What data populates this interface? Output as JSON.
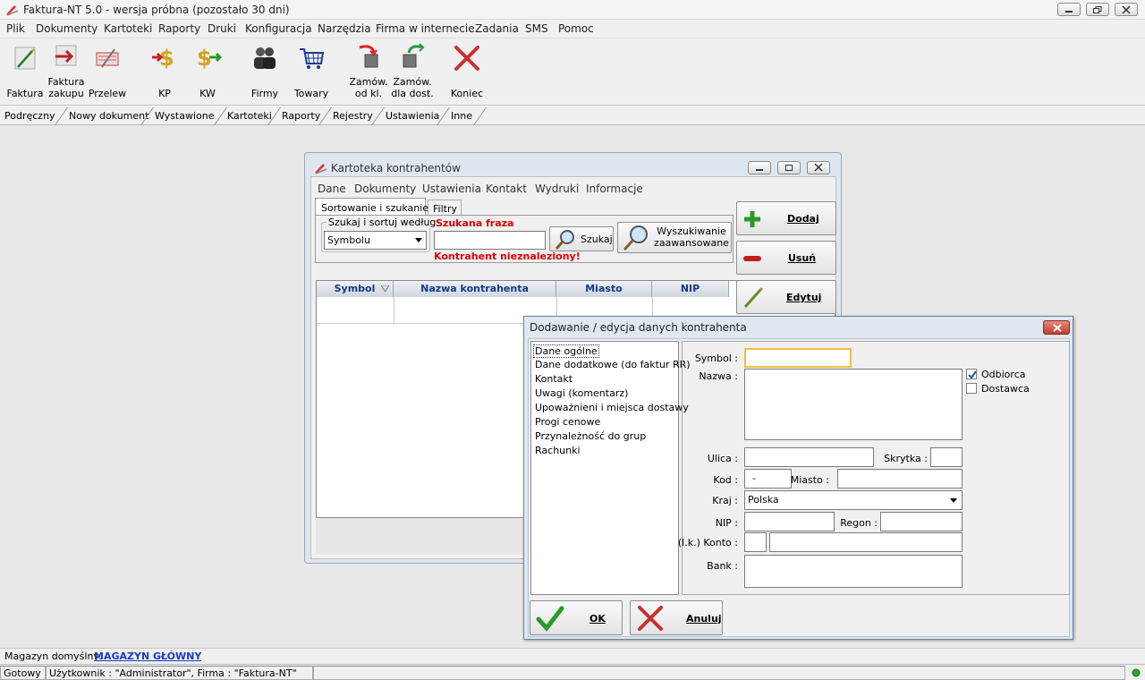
{
  "app": {
    "title": "Faktura-NT 5.0 - wersja próbna (pozostało 30 dni)"
  },
  "menu": [
    "Plik",
    "Dokumenty",
    "Kartoteki",
    "Raporty",
    "Druki",
    "Konfiguracja",
    "Narzędzia",
    "Firma w internecie",
    "Zadania",
    "SMS",
    "Pomoc"
  ],
  "toolbar": {
    "faktura": "Faktura",
    "faktura_zakupu_1": "Faktura",
    "faktura_zakupu_2": "zakupu",
    "przelew": "Przelew",
    "kp": "KP",
    "kw": "KW",
    "firmy": "Firmy",
    "towary": "Towary",
    "zamow_kl_1": "Zamów.",
    "zamow_kl_2": "od kl.",
    "zamow_dost_1": "Zamów.",
    "zamow_dost_2": "dla dost.",
    "koniec": "Koniec"
  },
  "tabs": [
    "Podręczny",
    "Nowy dokument",
    "Wystawione",
    "Kartoteki",
    "Raporty",
    "Rejestry",
    "Ustawienia",
    "Inne"
  ],
  "kartoteka": {
    "title": "Kartoteka kontrahentów",
    "menu": [
      "Dane",
      "Dokumenty",
      "Ustawienia",
      "Kontakt",
      "Wydruki",
      "Informacje"
    ],
    "tab_sort": "Sortowanie i szukanie",
    "tab_filtry": "Filtry",
    "group_label": "Szukaj i sortuj według",
    "sort_value": "Symbolu",
    "phrase_label": "Szukana fraza",
    "phrase_value": "",
    "not_found": "Kontrahent nieznaleziony!",
    "search_button": "Szukaj",
    "advanced_1": "Wyszukiwanie",
    "advanced_2": "zaawansowane",
    "columns": [
      "Symbol",
      "Nazwa kontrahenta",
      "Miasto",
      "NIP"
    ],
    "btn_dodaj": "Dodaj",
    "btn_usun": "Usuń",
    "btn_edytuj": "Edytuj"
  },
  "dialog": {
    "title": "Dodawanie / edycja danych kontrahenta",
    "nav": [
      "Dane ogólne",
      "Dane dodatkowe (do faktur RR)",
      "Kontakt",
      "Uwagi (komentarz)",
      "Upoważnieni i miejsca dostawy",
      "Progi cenowe",
      "Przynależność do grup",
      "Rachunki"
    ],
    "labels": {
      "symbol": "Symbol :",
      "nazwa": "Nazwa :",
      "ulica": "Ulica :",
      "skrytka": "Skrytka :",
      "kod": "Kod :",
      "miasto": "Miasto :",
      "kraj": "Kraj :",
      "nip": "NIP :",
      "regon": "Regon :",
      "konto": "(l.k.) Konto :",
      "bank": "Bank :"
    },
    "values": {
      "symbol": "",
      "nazwa": "",
      "ulica": "",
      "skrytka": "",
      "kod": "-",
      "miasto": "",
      "kraj": "Polska",
      "nip": "",
      "regon": "",
      "konto_lk": "",
      "konto": "",
      "bank": ""
    },
    "odbiorca": "Odbiorca",
    "odbiorca_checked": true,
    "dostawca": "Dostawca",
    "dostawca_checked": false,
    "ok": "OK",
    "anuluj": "Anuluj"
  },
  "status": {
    "magazyn_label": "Magazyn domyślny:",
    "magazyn_value": "MAGAZYN GŁÓWNY",
    "ready": "Gotowy",
    "user": "Użytkownik : \"Administrator\", Firma : \"Faktura-NT\""
  },
  "colors": {
    "accent_red": "#e00000",
    "link_blue": "#1a3cc8",
    "header_text": "#103a8a"
  }
}
